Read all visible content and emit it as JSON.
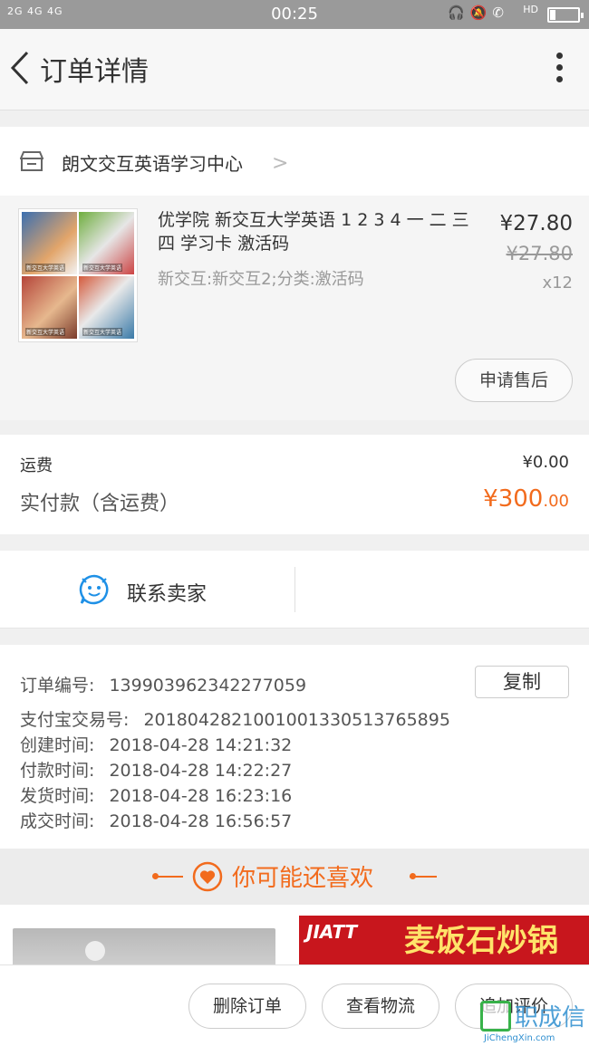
{
  "status_bar": {
    "signal": "2G 4G 4G",
    "time": "00:25",
    "hd": "HD",
    "battery_level": 0.2
  },
  "header": {
    "title": "订单详情"
  },
  "shop": {
    "name": "朗文交互英语学习中心"
  },
  "product": {
    "title": "优学院 新交互大学英语 1 2 3 4 一 二 三 四 学习卡 激活码",
    "spec": "新交互:新交互2;分类:激活码",
    "price": "¥27.80",
    "original_price": "¥27.80",
    "quantity": "x12",
    "thumb_label": "新交互大学英语",
    "after_sale_button": "申请售后"
  },
  "fees": {
    "shipping_label": "运费",
    "shipping_value": "¥0.00",
    "paid_label": "实付款（含运费）",
    "paid_currency": "¥",
    "paid_int": "300",
    "paid_dec": ".00"
  },
  "contact": {
    "label": "联系卖家"
  },
  "order_info": {
    "order_no_label": "订单编号:",
    "order_no": "139903962342277059",
    "copy_button": "复制",
    "alipay_label": "支付宝交易号:",
    "alipay_no": "2018042821001001330513765895",
    "created_label": "创建时间:",
    "created": "2018-04-28 14:21:32",
    "paid_label": "付款时间:",
    "paid": "2018-04-28 14:22:27",
    "shipped_label": "发货时间:",
    "shipped": "2018-04-28 16:23:16",
    "closed_label": "成交时间:",
    "closed": "2018-04-28 16:56:57"
  },
  "recommend": {
    "title": "你可能还喜欢",
    "ad_brand": "JIATT",
    "ad_product": "麦饭石炒锅"
  },
  "footer": {
    "delete_button": "删除订单",
    "logistics_button": "查看物流",
    "review_button": "追加评价"
  },
  "watermark": {
    "cn": "职成信",
    "en": "JiChengXin.com"
  },
  "colors": {
    "accent": "#f26b1d",
    "contact_blue": "#1e90e6"
  }
}
